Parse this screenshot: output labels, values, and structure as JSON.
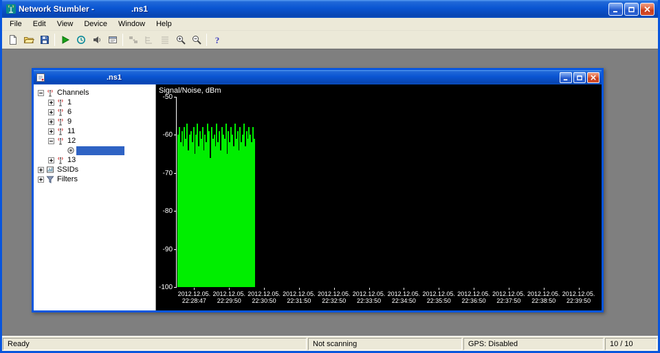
{
  "window": {
    "title": "Network Stumbler -",
    "doc_title": ".ns1"
  },
  "menu": {
    "items": [
      "File",
      "Edit",
      "View",
      "Device",
      "Window",
      "Help"
    ]
  },
  "toolbar": {
    "buttons": [
      {
        "name": "new-file",
        "glyph": "new"
      },
      {
        "name": "open-file",
        "glyph": "open"
      },
      {
        "name": "save-file",
        "glyph": "save"
      },
      {
        "name": "separator"
      },
      {
        "name": "start-scan",
        "glyph": "play"
      },
      {
        "name": "auto-reconfigure",
        "glyph": "scan"
      },
      {
        "name": "enable-sound",
        "glyph": "speaker"
      },
      {
        "name": "options",
        "glyph": "props"
      },
      {
        "name": "separator"
      },
      {
        "name": "renumber",
        "glyph": "renum",
        "disabled": true
      },
      {
        "name": "expand-tree",
        "glyph": "branch",
        "disabled": true
      },
      {
        "name": "details-view",
        "glyph": "details",
        "disabled": true
      },
      {
        "name": "zoom-in",
        "glyph": "zoomin"
      },
      {
        "name": "zoom-out",
        "glyph": "zoomout"
      },
      {
        "name": "separator"
      },
      {
        "name": "help",
        "glyph": "help"
      }
    ]
  },
  "child_window": {
    "title": ".ns1"
  },
  "tree": {
    "items": [
      {
        "id": "channels",
        "label": "Channels",
        "level": 0,
        "expand": "-",
        "icon": "antenna"
      },
      {
        "id": "channel-1",
        "label": "1",
        "level": 1,
        "expand": "+",
        "icon": "antenna"
      },
      {
        "id": "channel-6",
        "label": "6",
        "level": 1,
        "expand": "+",
        "icon": "antenna"
      },
      {
        "id": "channel-9",
        "label": "9",
        "level": 1,
        "expand": "+",
        "icon": "antenna"
      },
      {
        "id": "channel-11",
        "label": "11",
        "level": 1,
        "expand": "+",
        "icon": "antenna"
      },
      {
        "id": "channel-12",
        "label": "12",
        "level": 1,
        "expand": "-",
        "icon": "antenna"
      },
      {
        "id": "selected-station",
        "label": "",
        "level": 2,
        "expand": "",
        "icon": "ap",
        "selected": true
      },
      {
        "id": "channel-13",
        "label": "13",
        "level": 1,
        "expand": "+",
        "icon": "antenna"
      },
      {
        "id": "ssids",
        "label": "SSIDs",
        "level": 0,
        "expand": "+",
        "icon": "ssid"
      },
      {
        "id": "filters",
        "label": "Filters",
        "level": 0,
        "expand": "+",
        "icon": "filter"
      }
    ]
  },
  "chart_data": {
    "type": "area",
    "title": "Signal/Noise, dBm",
    "ylim": [
      -100,
      -50
    ],
    "yticks": [
      -50,
      -60,
      -70,
      -80,
      -90,
      -100
    ],
    "x_date": "2012.12.05.",
    "x_times": [
      "22:28:47",
      "22:29:50",
      "22:30:50",
      "22:31:50",
      "22:32:50",
      "22:33:50",
      "22:34:50",
      "22:35:50",
      "22:36:50",
      "22:37:50",
      "22:38:50",
      "22:39:50"
    ],
    "background": "#000000",
    "axis_color": "#ffffff",
    "signal_color": "#00ee00",
    "noise_floor": -100,
    "active_start_frac": 0.0,
    "active_end_frac": 0.185,
    "signal_top_values": [
      -60,
      -58,
      -62,
      -59,
      -63,
      -58,
      -61,
      -57,
      -64,
      -60,
      -59,
      -62,
      -58,
      -65,
      -60,
      -57,
      -63,
      -59,
      -61,
      -58,
      -64,
      -60,
      -62,
      -57,
      -59,
      -66,
      -58,
      -61,
      -60,
      -63,
      -57,
      -62,
      -59,
      -64,
      -58,
      -60,
      -61,
      -57,
      -65,
      -59,
      -62,
      -58,
      -60,
      -63,
      -57,
      -61,
      -59,
      -64,
      -58,
      -62,
      -60,
      -57,
      -63,
      -59,
      -61,
      -58,
      -60,
      -62,
      -58,
      -61
    ]
  },
  "statusbar": {
    "ready": "Ready",
    "scan_status": "Not scanning",
    "gps": "GPS: Disabled",
    "counter": "10 / 10"
  }
}
